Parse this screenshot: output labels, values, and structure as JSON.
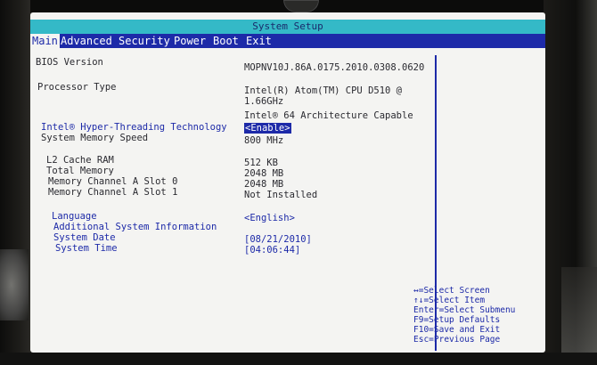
{
  "window": {
    "title": "System Setup"
  },
  "menu": {
    "main": "Main",
    "advanced": "Advanced",
    "security": "Security",
    "power": "Power",
    "boot": "Boot",
    "exit": "Exit"
  },
  "info": {
    "bios_version_label": "BIOS Version",
    "bios_version_value": "MOPNV10J.86A.0175.2010.0308.0620",
    "processor_type_label": "Processor Type",
    "processor_line1": "Intel(R) Atom(TM) CPU D510   @",
    "processor_line2": "1.66GHz",
    "processor_line3": "Intel® 64 Architecture Capable",
    "hyperthreading_label": "Intel® Hyper-Threading Technology",
    "hyperthreading_value": "<Enable>",
    "memory_speed_label": "System Memory Speed",
    "memory_speed_value": "800 MHz",
    "l2_cache_label": "L2 Cache RAM",
    "l2_cache_value": "512 KB",
    "total_memory_label": "Total Memory",
    "total_memory_value": "2048 MB",
    "slot0_label": "Memory Channel A Slot 0",
    "slot0_value": "2048 MB",
    "slot1_label": "Memory Channel A Slot 1",
    "slot1_value": "Not Installed",
    "language_label": "Language",
    "language_value": "<English>",
    "additional_info_label": "Additional System Information",
    "system_date_label": "System Date",
    "system_date_value": "[08/21/2010]",
    "system_time_label": "System Time",
    "system_time_value": "[04:06:44]"
  },
  "help": {
    "select_screen": "↔=Select Screen",
    "select_item": "↑↓=Select Item",
    "select_submenu": "Enter=Select Submenu",
    "setup_defaults": "F9=Setup Defaults",
    "save_exit": "F10=Save and Exit",
    "previous_page": "Esc=Previous Page"
  },
  "colors": {
    "title_bar": "#34b9c7",
    "menu_bar": "#1d2aa8",
    "screen_bg": "#f4f4f2",
    "text_dark": "#2a2a30",
    "text_blue": "#1d2aa8"
  }
}
